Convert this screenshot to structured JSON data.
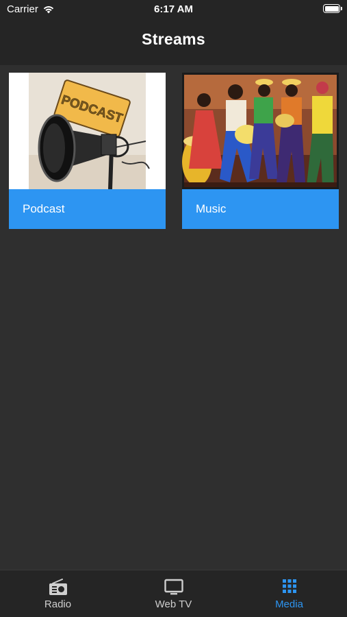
{
  "status_bar": {
    "carrier": "Carrier",
    "time": "6:17 AM",
    "wifi_icon": "wifi-icon",
    "battery_icon": "battery-icon"
  },
  "nav": {
    "title": "Streams"
  },
  "streams": [
    {
      "label": "Podcast",
      "image": "podcast-microphone-illustration",
      "sign_text": "PODCAST"
    },
    {
      "label": "Music",
      "image": "dancers-and-musicians-painting"
    }
  ],
  "tabbar": {
    "tabs": [
      {
        "label": "Radio",
        "icon": "radio-icon",
        "active": false
      },
      {
        "label": "Web TV",
        "icon": "tv-icon",
        "active": false
      },
      {
        "label": "Media",
        "icon": "grid-icon",
        "active": true
      }
    ]
  },
  "colors": {
    "background": "#2f2f2f",
    "bars": "#252525",
    "accent": "#2d95f2",
    "tab_inactive": "#cfcfcf"
  }
}
